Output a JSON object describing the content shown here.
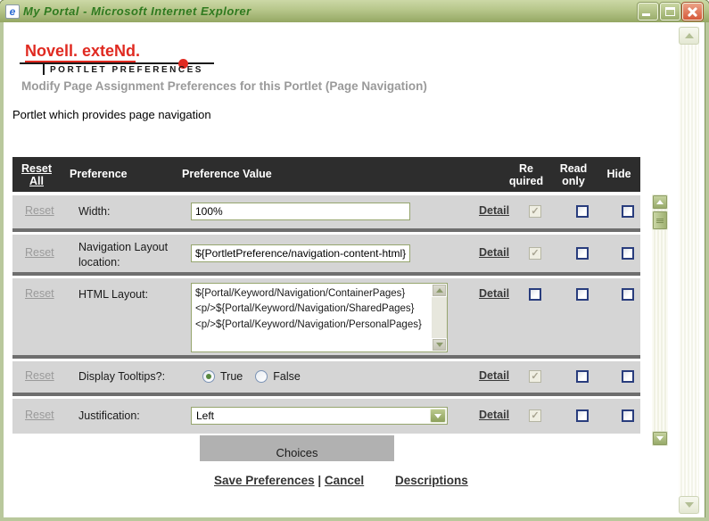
{
  "window": {
    "title": "My Portal - Microsoft Internet Explorer"
  },
  "logo": {
    "brand": "Novell. exteNd.",
    "subtitle": "PORTLET PREFERENCES"
  },
  "page": {
    "heading": "Modify Page Assignment Preferences for this Portlet (Page Navigation)",
    "description": "Portlet which provides page navigation"
  },
  "table": {
    "header": {
      "reset_all_line1": "Reset",
      "reset_all_line2": "All",
      "preference": "Preference",
      "preference_value": "Preference Value",
      "required_line1": "Re",
      "required_line2": "quired",
      "readonly_line1": "Read",
      "readonly_line2": "only",
      "hide": "Hide"
    },
    "reset_label": "Reset",
    "detail_label": "Detail",
    "rows": [
      {
        "label": "Width:",
        "type": "text",
        "value": "100%",
        "required": true,
        "readonly": false,
        "hide": false
      },
      {
        "label": "Navigation Layout location:",
        "type": "text",
        "value": "${PortletPreference/navigation-content-html}",
        "required": true,
        "readonly": false,
        "hide": false
      },
      {
        "label": "HTML Layout:",
        "type": "textarea",
        "value": "${Portal/Keyword/Navigation/ContainerPages}\n<p/>${Portal/Keyword/Navigation/SharedPages}\n<p/>${Portal/Keyword/Navigation/PersonalPages}",
        "required": false,
        "readonly": false,
        "hide": false
      },
      {
        "label": "Display Tooltips?:",
        "type": "radio",
        "options": [
          "True",
          "False"
        ],
        "selected": "True",
        "required": true,
        "readonly": false,
        "hide": false
      },
      {
        "label": "Justification:",
        "type": "select",
        "value": "Left",
        "required": true,
        "readonly": false,
        "hide": false
      }
    ],
    "choices_button": "Choices"
  },
  "footer": {
    "save": "Save Preferences",
    "divider": "|",
    "cancel": "Cancel",
    "descriptions": "Descriptions"
  },
  "colors": {
    "accent_red": "#e02a21",
    "titlebar_text": "#2f7a1f",
    "header_bg": "#2d2d2d",
    "row_bg": "#d5d5d5",
    "checkbox_border": "#293d7d"
  }
}
